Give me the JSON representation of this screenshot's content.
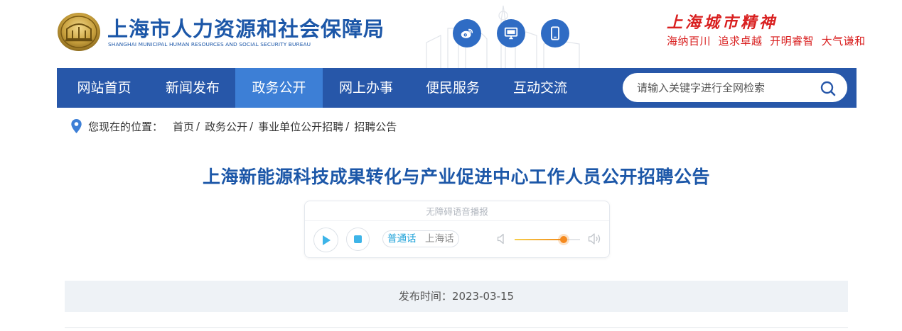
{
  "header": {
    "org_name_cn": "上海市人力资源和社会保障局",
    "org_name_en": "SHANGHAI MUNICIPAL HUMAN RESOURCES AND SOCIAL SECURITY BUREAU",
    "social_icons": [
      "weibo-icon",
      "desktop-icon",
      "mobile-icon"
    ],
    "spirit_title": "上海城市精神",
    "spirit_slogan": "海纳百川  追求卓越  开明睿智  大气谦和"
  },
  "nav": {
    "items": [
      {
        "label": "网站首页",
        "active": false
      },
      {
        "label": "新闻发布",
        "active": false
      },
      {
        "label": "政务公开",
        "active": true
      },
      {
        "label": "网上办事",
        "active": false
      },
      {
        "label": "便民服务",
        "active": false
      },
      {
        "label": "互动交流",
        "active": false
      }
    ],
    "search_placeholder": "请输入关键字进行全网检索"
  },
  "breadcrumb": {
    "label": "您现在的位置：",
    "items": [
      "首页",
      "政务公开",
      "事业单位公开招聘",
      "招聘公告"
    ],
    "separator": "/"
  },
  "article": {
    "title": "上海新能源科技成果转化与产业促进中心工作人员公开招聘公告",
    "publish_label": "发布时间：",
    "publish_date": "2023-03-15"
  },
  "player": {
    "label": "无障碍语音播报",
    "dialects": [
      {
        "label": "普通话",
        "selected": true
      },
      {
        "label": "上海话",
        "selected": false
      }
    ],
    "volume": 0.75
  },
  "colors": {
    "primary_blue": "#2757a9",
    "active_tab": "#3d7fd6",
    "title_blue": "#1c57a8",
    "spirit_red": "#d92020",
    "player_accent": "#3db4e8",
    "volume_orange": "#f58a1f"
  }
}
